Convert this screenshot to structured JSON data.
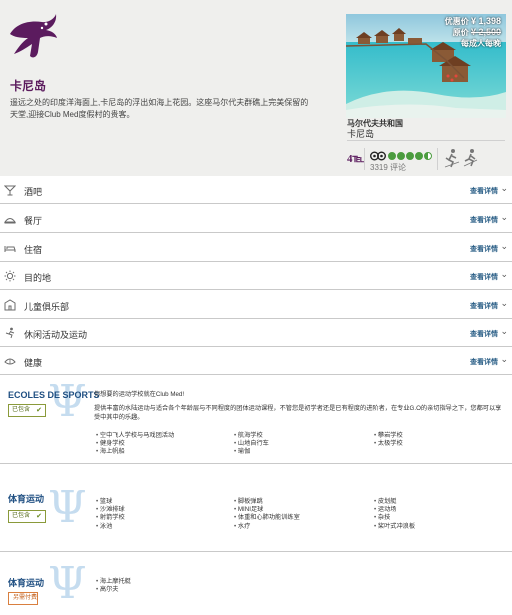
{
  "resort": {
    "title": "卡尼岛",
    "description": "遥远之处的印度洋海面上,卡尼岛的浮出如海上花园。这座马尔代夫群礁上完美保留的天堂,迎接Club Med度假村的贵客。",
    "country": "马尔代夫共和国",
    "name": "卡尼岛",
    "tier": "4℡",
    "reviews_count": "3319 评论"
  },
  "price": {
    "deal_label": "优惠价",
    "deal_amount": "¥ 1,398",
    "original_label": "原价",
    "original_amount": "¥ 2,500",
    "unit": "每成人每晚"
  },
  "tripadvisor": {
    "rating": 4.5
  },
  "accordion": {
    "more_label": "查看详情",
    "items": [
      {
        "label": "酒吧",
        "icon": "cocktail-icon"
      },
      {
        "label": "餐厅",
        "icon": "dining-icon"
      },
      {
        "label": "住宿",
        "icon": "bed-icon"
      },
      {
        "label": "目的地",
        "icon": "sun-icon"
      },
      {
        "label": "儿童俱乐部",
        "icon": "kids-icon"
      },
      {
        "label": "休闲活动及运动",
        "icon": "sports-icon"
      },
      {
        "label": "健康",
        "icon": "wellness-icon"
      }
    ]
  },
  "sections": {
    "ecoles": {
      "title": "ECOLES DE SPORTS",
      "status": "已包含",
      "intro_line1": "你想要的运动学校就在Club Med!",
      "intro_line2": "提供丰富的水陆运动与适合各个年龄层与不同程度的团体运动课程，不管您是初学者还是已有程度的进阶者，在专业G.O的亲切指导之下，您都可以享受中其中的乐趣。",
      "columns": [
        [
          "空中飞人学校与马戏团活动",
          "健身学校",
          "海上帆船"
        ],
        [
          "航海学校",
          "山地自行车",
          "瑜伽"
        ],
        [
          "攀岩学校",
          "太极学校"
        ]
      ]
    },
    "sports_included": {
      "title": "体育运动",
      "status": "已包含",
      "columns": [
        [
          "篮球",
          "沙滩排球",
          "射箭学校",
          "泳池"
        ],
        [
          "脚板弹跳",
          "MINI足球",
          "体重和心肺功能训练室",
          "水疗"
        ],
        [
          "皮划艇",
          "运动场",
          "杂技",
          "桨叶式冲浪板"
        ]
      ]
    },
    "sports_extra": {
      "title": "体育运动",
      "status": "另需付费",
      "columns": [
        [
          "海上摩托艇",
          "高尔夫"
        ]
      ]
    }
  },
  "colors": {
    "brand": "#5b1b5e",
    "link": "#2b5f87",
    "section_title": "#1f4f82"
  }
}
